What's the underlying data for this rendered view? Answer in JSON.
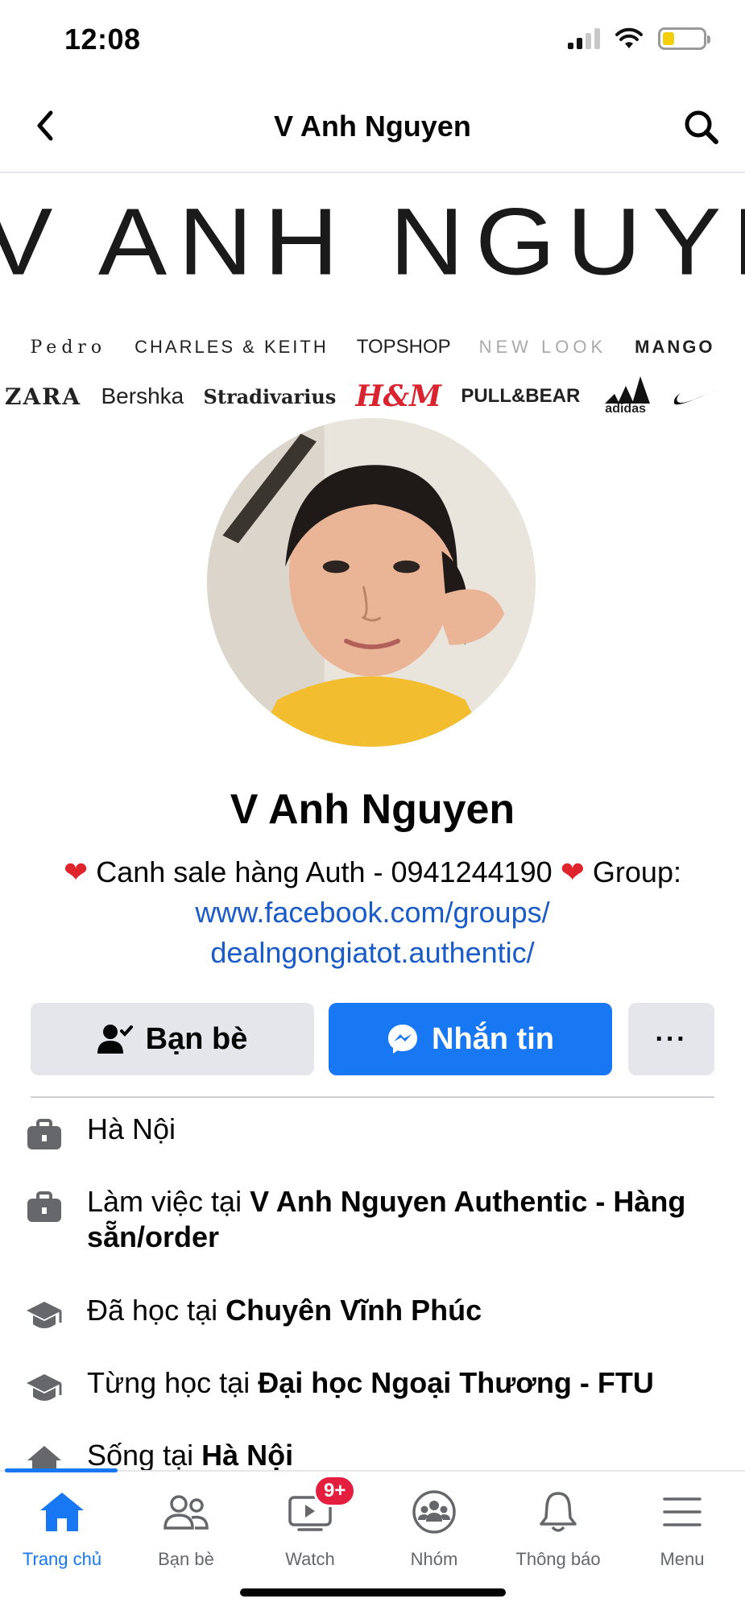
{
  "status_bar": {
    "time": "12:08"
  },
  "header": {
    "title": "V Anh Nguyen"
  },
  "cover": {
    "title": "V ANH NGUYEN",
    "brands_row1": [
      "Pedro",
      "CHARLES & KEITH",
      "TOPSHOP",
      "NEW LOOK",
      "MANGO"
    ],
    "brands_row2": [
      "ZARA",
      "Bershka",
      "Stradivarius",
      "H&M",
      "PULL&BEAR",
      "adidas"
    ]
  },
  "profile": {
    "name": "V Anh Nguyen",
    "bio_text": "Canh sale hàng Auth - 0941244190",
    "bio_group_label": "Group:",
    "bio_link_line1": "www.facebook.com/groups/",
    "bio_link_line2": "dealngongiatot.authentic/"
  },
  "actions": {
    "friends_label": "Bạn bè",
    "message_label": "Nhắn tin",
    "more_label": "···"
  },
  "details": [
    {
      "icon": "briefcase-icon",
      "prefix": "",
      "bold": "",
      "text": "Hà Nội"
    },
    {
      "icon": "briefcase-icon",
      "prefix": "Làm việc tại ",
      "bold": "V Anh Nguyen Authentic - Hàng sẵn/order"
    },
    {
      "icon": "graduation-cap-icon",
      "prefix": "Đã học tại ",
      "bold": "Chuyên Vĩnh Phúc"
    },
    {
      "icon": "graduation-cap-icon",
      "prefix": "Từng học tại ",
      "bold": "Đại học Ngoại Thương - FTU"
    },
    {
      "icon": "home-icon",
      "prefix": "Sống tại ",
      "bold": "Hà Nội"
    }
  ],
  "tabs": [
    {
      "label": "Trang chủ",
      "icon": "home-icon",
      "active": true
    },
    {
      "label": "Bạn bè",
      "icon": "friends-icon"
    },
    {
      "label": "Watch",
      "icon": "watch-icon",
      "badge": "9+"
    },
    {
      "label": "Nhóm",
      "icon": "groups-icon"
    },
    {
      "label": "Thông báo",
      "icon": "bell-icon"
    },
    {
      "label": "Menu",
      "icon": "menu-icon"
    }
  ],
  "colors": {
    "accent": "#1877f2",
    "badge": "#e41e3f",
    "link": "#1a5bc8"
  }
}
